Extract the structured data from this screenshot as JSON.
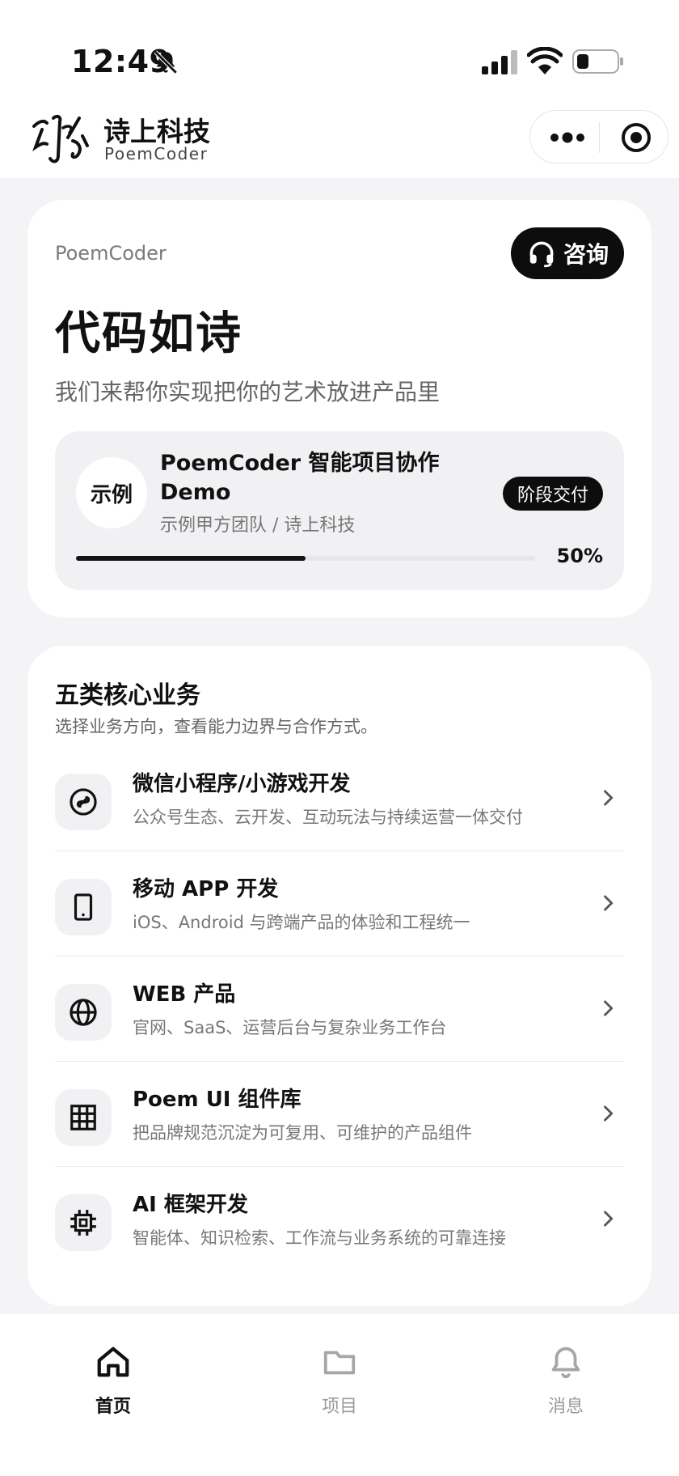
{
  "status_bar": {
    "time": "12:49"
  },
  "header": {
    "brand_name": "诗上科技",
    "brand_sub": "PoemCoder"
  },
  "hero": {
    "eyebrow": "PoemCoder",
    "consult_label": "咨询",
    "title": "代码如诗",
    "subtitle": "我们来帮你实现把你的艺术放进产品里",
    "demo": {
      "avatar_text": "示例",
      "title": "PoemCoder 智能项目协作 Demo",
      "team": "示例甲方团队 / 诗上科技",
      "badge": "阶段交付",
      "progress": 0.5,
      "progress_label": "50%"
    }
  },
  "services": {
    "title": "五类核心业务",
    "subtitle": "选择业务方向，查看能力边界与合作方式。",
    "items": [
      {
        "icon": "link-icon",
        "title": "微信小程序/小游戏开发",
        "desc": "公众号生态、云开发、互动玩法与持续运营一体交付"
      },
      {
        "icon": "phone-icon",
        "title": "移动 APP 开发",
        "desc": "iOS、Android 与跨端产品的体验和工程统一"
      },
      {
        "icon": "globe-icon",
        "title": "WEB 产品",
        "desc": "官网、SaaS、运营后台与复杂业务工作台"
      },
      {
        "icon": "grid-icon",
        "title": "Poem UI 组件库",
        "desc": "把品牌规范沉淀为可复用、可维护的产品组件"
      },
      {
        "icon": "chip-icon",
        "title": "AI 框架开发",
        "desc": "智能体、知识检索、工作流与业务系统的可靠连接"
      }
    ]
  },
  "tabbar": {
    "items": [
      {
        "label": "首页",
        "icon": "home-icon",
        "active": true
      },
      {
        "label": "项目",
        "icon": "folder-icon",
        "active": false
      },
      {
        "label": "消息",
        "icon": "bell-icon",
        "active": false
      }
    ]
  },
  "colors": {
    "accent": "#0d0d0d",
    "background": "#f4f4f6",
    "card": "#ffffff",
    "muted": "#777777"
  }
}
